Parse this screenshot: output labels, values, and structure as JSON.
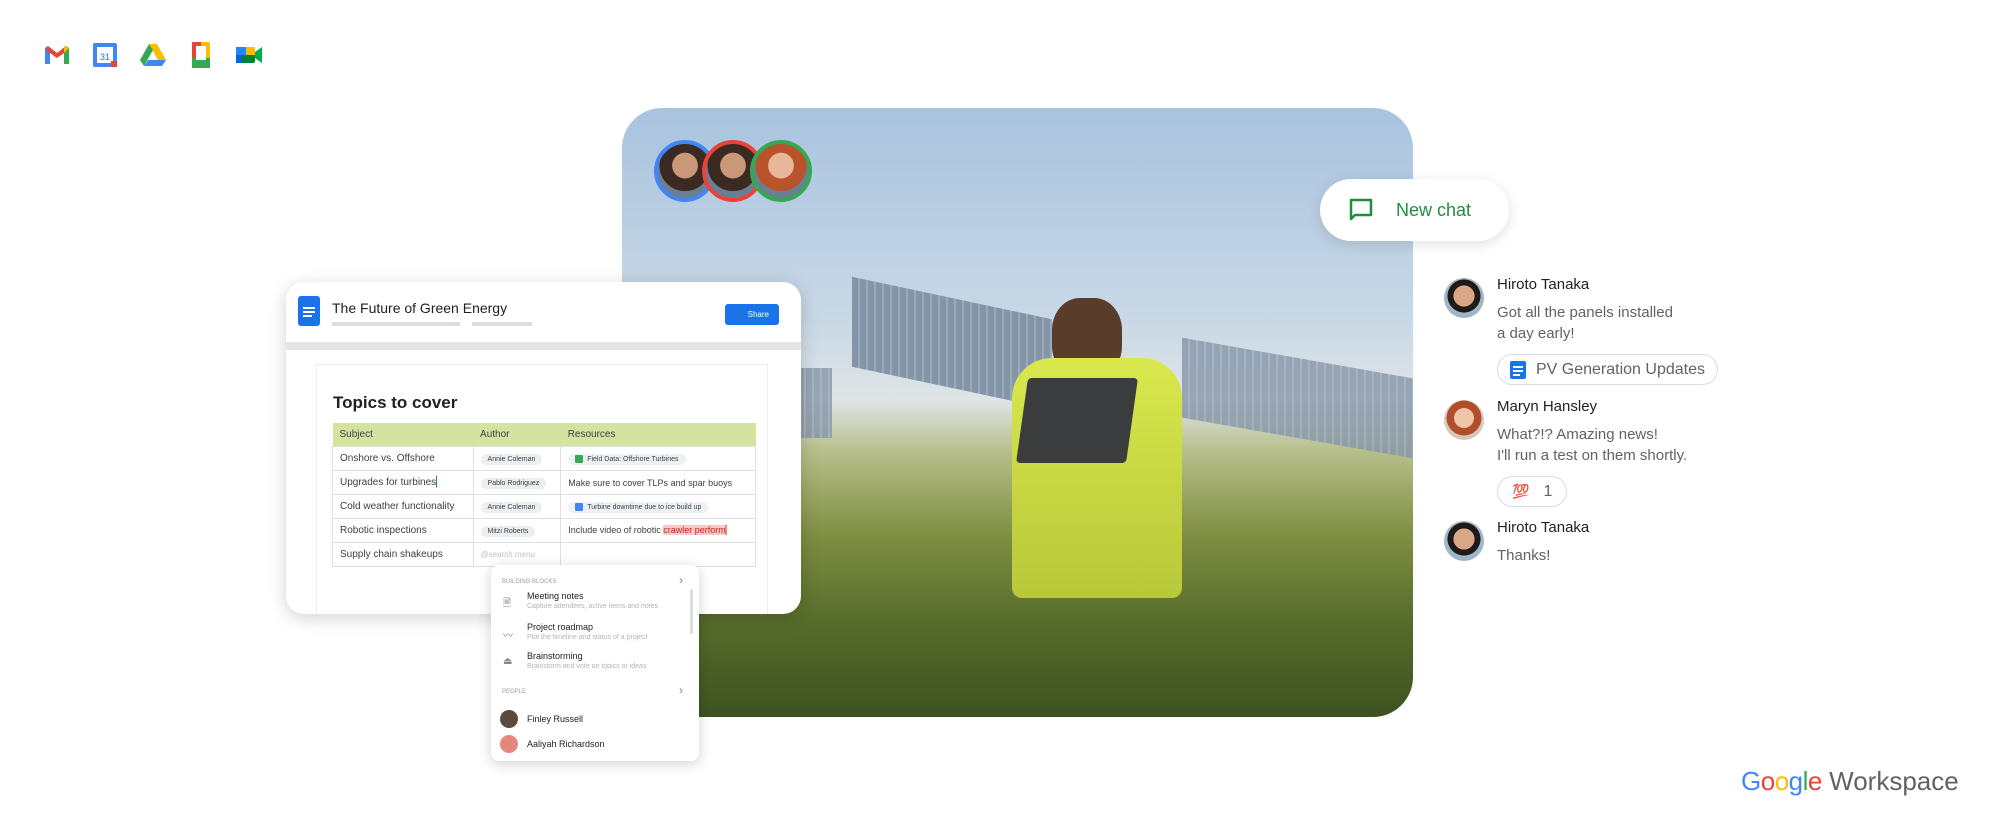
{
  "apps": [
    {
      "icon": "gmail-icon"
    },
    {
      "icon": "calendar-icon",
      "label": "31"
    },
    {
      "icon": "drive-icon"
    },
    {
      "icon": "docs-icon"
    },
    {
      "icon": "meet-icon"
    }
  ],
  "doc": {
    "title": "The Future of Green Energy",
    "share_label": "Share",
    "heading": "Topics to cover",
    "columns": [
      "Subject",
      "Author",
      "Resources"
    ],
    "rows": [
      {
        "subject": "Onshore vs. Offshore",
        "author": "Annie Coleman",
        "resource": "Field Data: Offshore Turbines",
        "resource_type": "sheets-chip"
      },
      {
        "subject": "Upgrades for turbines",
        "author": "Pablo Rodriguez",
        "resource": "Make sure to cover TLPs and spar buoys",
        "resource_type": "text"
      },
      {
        "subject": "Cold weather functionality",
        "author": "Annie Coleman",
        "resource": "Turbine downtime due to ice build up",
        "resource_type": "docs-chip"
      },
      {
        "subject": "Robotic inspections",
        "author": "Mitzi Roberts",
        "resource": "Include video of robotic ",
        "resource_highlight": "crawler perform",
        "resource_type": "text"
      },
      {
        "subject": "Supply chain shakeups",
        "author": "@search menu",
        "resource": "",
        "resource_type": "text"
      }
    ]
  },
  "menu": {
    "section1": "BUILDING BLOCKS",
    "items": [
      {
        "title": "Meeting notes",
        "desc": "Capture attendees, active items and notes",
        "icon": "document-icon"
      },
      {
        "title": "Project roadmap",
        "desc": "Plot the timeline and status of a project",
        "icon": "trend-icon"
      },
      {
        "title": "Brainstorming",
        "desc": "Brainstorm and vote on topics or ideas",
        "icon": "vote-icon"
      }
    ],
    "section2": "PEOPLE",
    "people": [
      "Finley Russell",
      "Aaliyah Richardson"
    ]
  },
  "colors": {
    "blue": "#4285f4",
    "red": "#ea4335",
    "green": "#34a853",
    "yellow": "#fbbc04",
    "chat_green": "#1e8e3e"
  },
  "chat": {
    "new_chat": "New chat",
    "messages": [
      {
        "name": "Hiroto Tanaka",
        "lines": [
          "Got all the panels installed",
          "a day early!"
        ],
        "attachment": "PV Generation Updates"
      },
      {
        "name": "Maryn Hansley",
        "lines": [
          "What?!? Amazing news!",
          "I'll run a test on them shortly."
        ],
        "reaction": "💯",
        "reaction_count": "1"
      },
      {
        "name": "Hiroto Tanaka",
        "lines": [
          "Thanks!"
        ]
      }
    ]
  },
  "brand": {
    "google": "Google",
    "workspace": "Workspace"
  }
}
